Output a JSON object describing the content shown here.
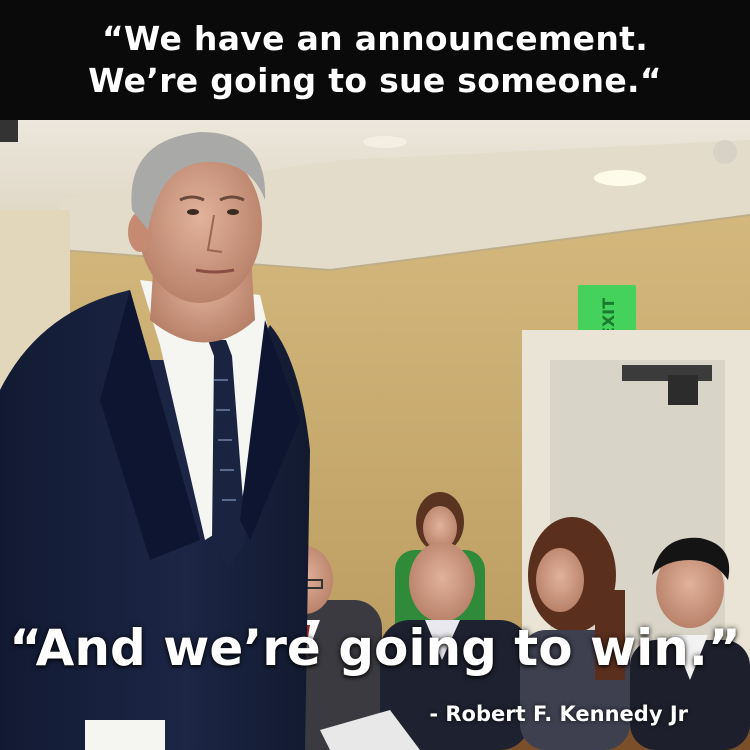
{
  "meme": {
    "top_quote_line1": "“We have an announcement.",
    "top_quote_line2": "We’re going to sue someone.“",
    "bottom_quote": "“And we’re going to win.”",
    "attribution": "- Robert F. Kennedy Jr"
  },
  "photo": {
    "scene": "courtroom",
    "exit_sign_icon": "exit-sign-icon"
  },
  "colors": {
    "banner": "#0a0a0a",
    "wall": "#c9ac6e",
    "suit": "#18213c",
    "exit_sign": "#2ec04c",
    "text": "#ffffff"
  }
}
